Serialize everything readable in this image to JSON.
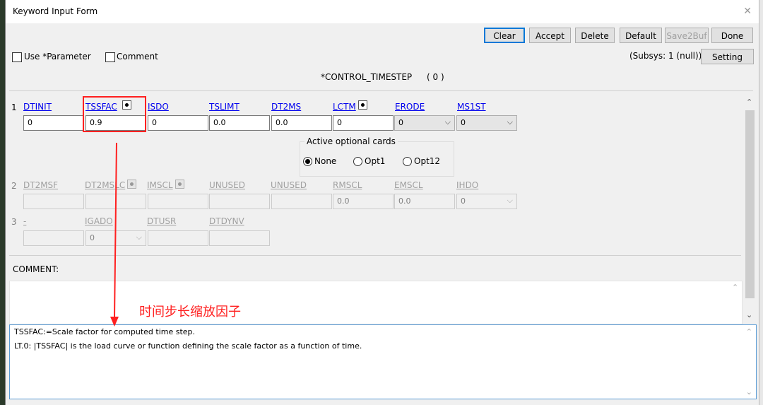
{
  "window": {
    "title": "Keyword Input Form"
  },
  "toolbar": {
    "clear": "Clear",
    "accept": "Accept",
    "delete": "Delete",
    "default": "Default",
    "save2buf": "Save2Buf",
    "done": "Done",
    "setting": "Setting"
  },
  "options": {
    "use_parameter": "Use *Parameter",
    "comment": "Comment",
    "subsys": "(Subsys: 1 (null))"
  },
  "keyword": {
    "name": "*CONTROL_TIMESTEP",
    "id": "( 0 )"
  },
  "card1": {
    "row": "1",
    "fields": [
      {
        "label": "DTINIT",
        "value": "0"
      },
      {
        "label": "TSSFAC",
        "value": "0.9"
      },
      {
        "label": "ISDO",
        "value": "0"
      },
      {
        "label": "TSLIMT",
        "value": "0.0"
      },
      {
        "label": "DT2MS",
        "value": "0.0"
      },
      {
        "label": "LCTM",
        "value": "0"
      },
      {
        "label": "ERODE",
        "value": "0"
      },
      {
        "label": "MS1ST",
        "value": "0"
      }
    ]
  },
  "optional_cards": {
    "title": "Active optional cards",
    "none": "None",
    "opt1": "Opt1",
    "opt12": "Opt12",
    "selected": "None"
  },
  "card2": {
    "row": "2",
    "fields": [
      {
        "label": "DT2MSF",
        "value": ""
      },
      {
        "label": "DT2MSLC",
        "value": ""
      },
      {
        "label": "IMSCL",
        "value": ""
      },
      {
        "label": "UNUSED",
        "value": ""
      },
      {
        "label": "UNUSED",
        "value": ""
      },
      {
        "label": "RMSCL",
        "value": "0.0"
      },
      {
        "label": "EMSCL",
        "value": "0.0"
      },
      {
        "label": "IHDO",
        "value": "0"
      }
    ]
  },
  "card3": {
    "row": "3",
    "fields": [
      {
        "label": "-",
        "value": ""
      },
      {
        "label": "IGADO",
        "value": "0"
      },
      {
        "label": "DTUSR",
        "value": ""
      },
      {
        "label": "DTDYNV",
        "value": ""
      }
    ]
  },
  "comment_label": "COMMENT:",
  "annotation": "时间步长缩放因子",
  "help": {
    "line1": "TSSFAC:=Scale factor for computed time step.",
    "line2": "LT.0: |TSSFAC| is the load curve or function defining the scale factor as a function of time."
  },
  "colors": {
    "annotation": "#ff2020",
    "link": "#0000ee",
    "accent": "#0078d7"
  }
}
